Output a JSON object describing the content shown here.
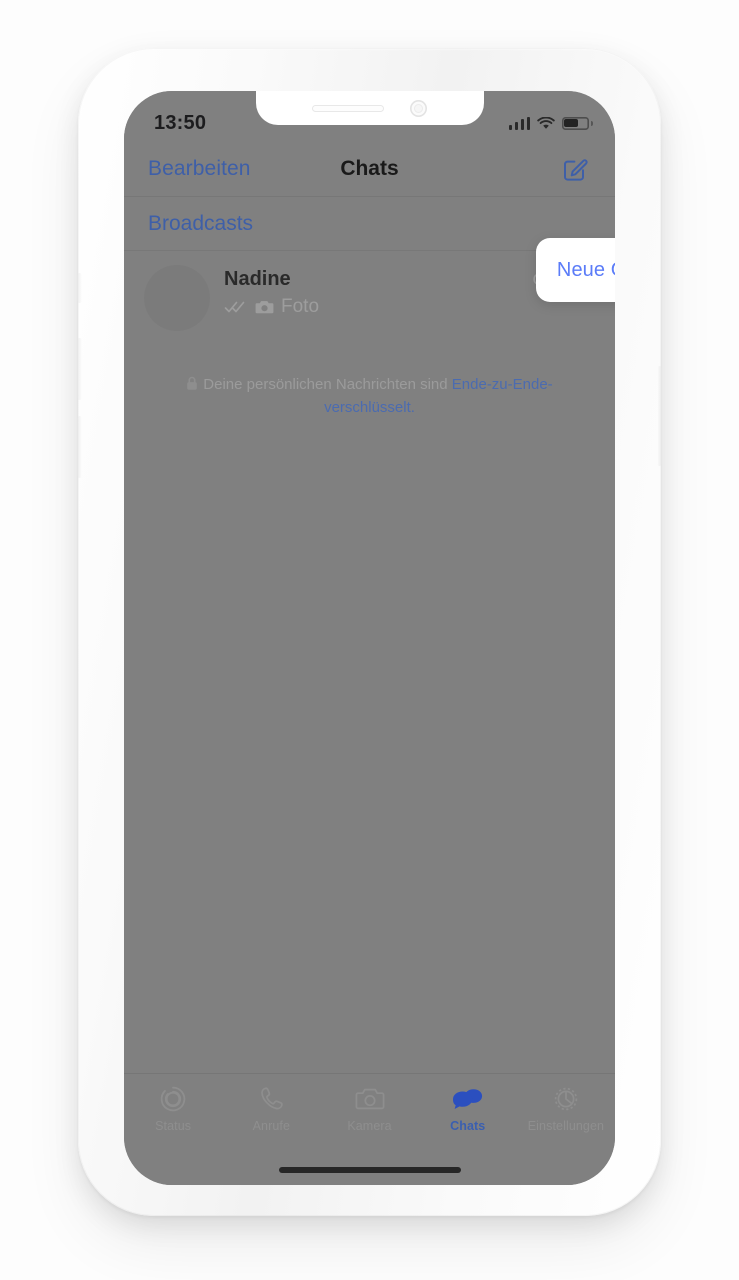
{
  "device": {
    "status_bar": {
      "time": "13:50",
      "signal_icon": "cellular-bars-icon",
      "wifi_icon": "wifi-icon",
      "battery_icon": "battery-icon"
    },
    "notch": {
      "speaker_icon": "speaker-slot-icon",
      "camera_icon": "front-camera-icon"
    },
    "home_indicator": "home-indicator"
  },
  "nav_bar": {
    "edit_label": "Bearbeiten",
    "title": "Chats",
    "compose_icon": "compose-icon"
  },
  "broadcasts": {
    "label": "Broadcasts"
  },
  "popup": {
    "items": [
      {
        "label": "Neue Gruppe"
      }
    ]
  },
  "chats": [
    {
      "name": "Nadine",
      "time": "Gestern",
      "status_icon": "double-check-icon",
      "attachment_icon": "camera-icon",
      "preview": "Foto",
      "avatar_icon": "avatar-placeholder"
    }
  ],
  "encryption_notice": {
    "lock_icon": "lock-icon",
    "text": "Deine persönlichen Nachrichten sind ",
    "link_text": "Ende-zu-Ende-verschlüsselt."
  },
  "tab_bar": {
    "tabs": [
      {
        "label": "Status",
        "icon": "status-rings-icon",
        "active": false
      },
      {
        "label": "Anrufe",
        "icon": "phone-icon",
        "active": false
      },
      {
        "label": "Kamera",
        "icon": "camera-icon",
        "active": false
      },
      {
        "label": "Chats",
        "icon": "chat-bubbles-icon",
        "active": true
      },
      {
        "label": "Einstellungen",
        "icon": "gear-icon",
        "active": false
      }
    ]
  },
  "colors": {
    "accent_blue": "#3e5fa8",
    "popup_blue": "#5b7cf8",
    "screen_dim": "#808080",
    "case": "#fafafa"
  }
}
